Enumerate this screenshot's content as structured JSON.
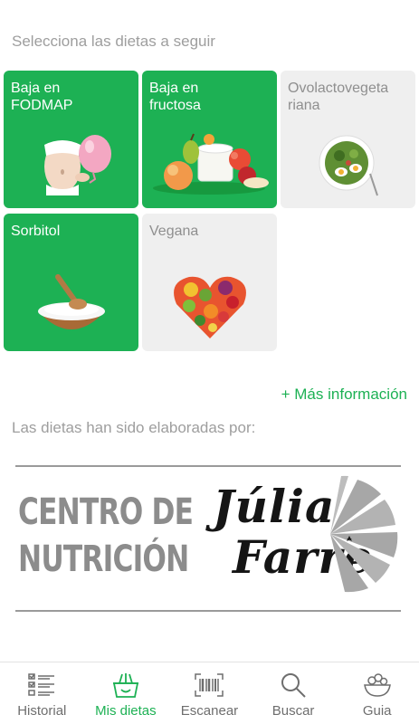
{
  "prompt": "Selecciona las dietas a seguir",
  "diets": [
    {
      "label": "Baja en\nFODMAP",
      "selected": true,
      "image": "woman-with-balloon"
    },
    {
      "label": "Baja en\nfructosa",
      "selected": true,
      "image": "fruits-and-yogurt"
    },
    {
      "label": "Ovolactovegeta\nriana",
      "selected": false,
      "image": "salad-bowl-with-eggs"
    },
    {
      "label": "Sorbitol",
      "selected": true,
      "image": "wooden-bowl-of-sugar"
    },
    {
      "label": "Vegana",
      "selected": false,
      "image": "fruit-heart"
    }
  ],
  "more_info": "+ Más información",
  "credits": "Las dietas han sido elaboradas por:",
  "logo": {
    "left_line1": "CENTRO DE",
    "left_line2": "NUTRICIÓN",
    "script_line1": "Júlia",
    "script_line2": "Farre"
  },
  "tabs": [
    {
      "label": "Historial",
      "icon": "checklist-icon",
      "active": false
    },
    {
      "label": "Mis dietas",
      "icon": "basket-icon",
      "active": true
    },
    {
      "label": "Escanear",
      "icon": "barcode-icon",
      "active": false
    },
    {
      "label": "Buscar",
      "icon": "search-icon",
      "active": false
    },
    {
      "label": "Guia",
      "icon": "food-bowl-icon",
      "active": false
    }
  ],
  "colors": {
    "accent": "#1db154",
    "card_off": "#efefef",
    "muted_text": "#9e9e9e"
  }
}
